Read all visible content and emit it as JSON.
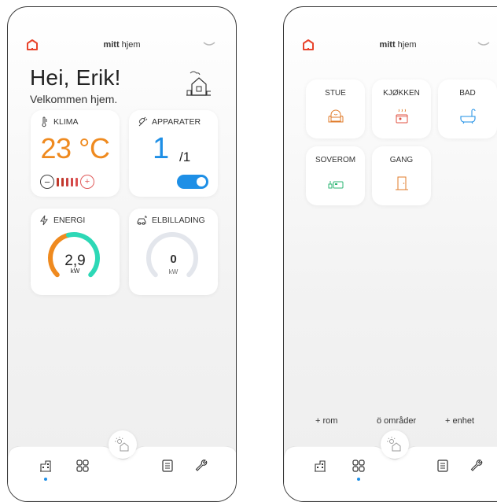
{
  "app": {
    "brand_bold": "mitt",
    "brand_rest": " hjem"
  },
  "home": {
    "greeting": "Hei, Erik!",
    "welcome": "Velkommen hjem.",
    "klima": {
      "title": "KLIMA",
      "temp": "23 °C"
    },
    "apparater": {
      "title": "APPARATER",
      "on": "1",
      "total": "/1",
      "toggle_on": true
    },
    "energi": {
      "title": "ENERGI",
      "value": "2,9",
      "unit": "kW",
      "level": 0.55
    },
    "elbil": {
      "title": "ELBILLADING",
      "value": "0",
      "unit": "kW",
      "level": 0
    }
  },
  "rooms": {
    "items": [
      {
        "label": "STUE",
        "icon": "armchair-icon"
      },
      {
        "label": "KJØKKEN",
        "icon": "stove-icon"
      },
      {
        "label": "BAD",
        "icon": "bathtub-icon"
      },
      {
        "label": "SOVEROM",
        "icon": "bed-icon"
      },
      {
        "label": "GANG",
        "icon": "door-icon"
      }
    ],
    "add_room": "+ rom",
    "add_area": "ö områder",
    "add_unit": "+ enhet"
  },
  "colors": {
    "accent": "#1e8fe6",
    "orange": "#ef8a1f",
    "red": "#d73a3a",
    "teal": "#2dd8b6",
    "logo": "#e8442c"
  }
}
